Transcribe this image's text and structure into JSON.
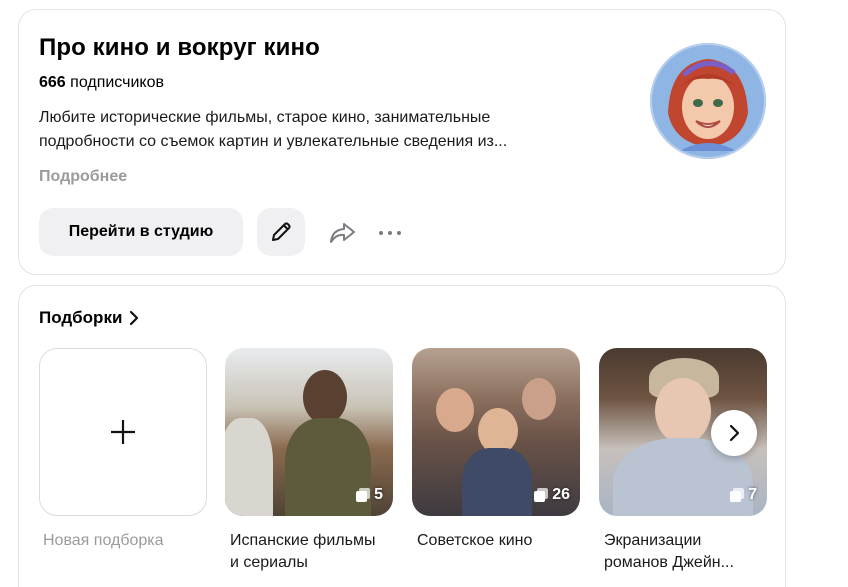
{
  "channel": {
    "title": "Про кино и вокруг кино",
    "subscribers_count": "666",
    "subscribers_label": "подписчиков",
    "description_line1": "Любите исторические фильмы, старое кино, занимательные",
    "description_line2": "подробности со съемок картин и увлекательные сведения из...",
    "more_label": "Подробнее",
    "studio_button": "Перейти в студию",
    "edit_icon": "pencil-icon",
    "share_icon": "share-arrow-icon",
    "more_icon": "ellipsis-icon"
  },
  "collections": {
    "title": "Подборки",
    "new_label": "Новая подборка",
    "items": [
      {
        "label_line1": "Испанские фильмы",
        "label_line2": "и сериалы",
        "count": "5"
      },
      {
        "label_line1": "Советское кино",
        "label_line2": "",
        "count": "26"
      },
      {
        "label_line1": "Экранизации",
        "label_line2": "романов Джейн...",
        "count": "7"
      }
    ]
  },
  "colors": {
    "button_bg": "#f0f0f2",
    "muted_text": "#9b9b9e",
    "border": "#e3e3e6"
  }
}
